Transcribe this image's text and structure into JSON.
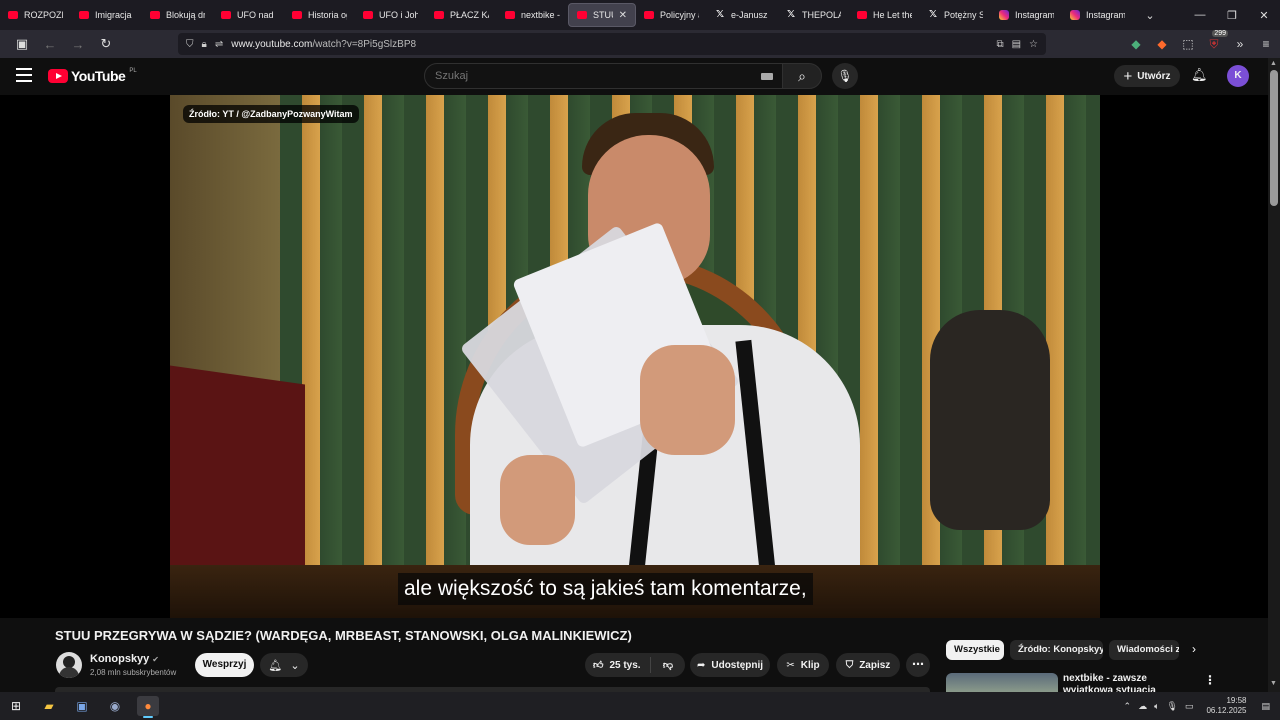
{
  "browser": {
    "tabs": [
      {
        "label": "ROZPOZNA",
        "icon": "youtube-icon"
      },
      {
        "label": "Imigracja w",
        "icon": "youtube-icon"
      },
      {
        "label": "Blokują dro",
        "icon": "youtube-icon"
      },
      {
        "label": "UFO nad W",
        "icon": "youtube-icon"
      },
      {
        "label": "Historia ogl",
        "icon": "youtube-icon"
      },
      {
        "label": "UFO i John",
        "icon": "youtube-icon"
      },
      {
        "label": "PŁACZ KASI",
        "icon": "youtube-icon"
      },
      {
        "label": "nextbike - z",
        "icon": "youtube-icon"
      },
      {
        "label": "STUU PR",
        "icon": "youtube-icon",
        "active": true
      },
      {
        "label": "Policyjny ag",
        "icon": "youtube-icon"
      },
      {
        "label": "e-Janusz Ch",
        "icon": "x-icon"
      },
      {
        "label": "THEPOLAN",
        "icon": "x-icon"
      },
      {
        "label": "He Let the I",
        "icon": "youtube-icon"
      },
      {
        "label": "Potężny Set",
        "icon": "x-icon"
      },
      {
        "label": "Instagram",
        "icon": "instagram-icon"
      },
      {
        "label": "Instagram",
        "icon": "instagram-icon"
      }
    ],
    "url_host": "www.youtube.com",
    "url_path": "/watch?v=8Pi5gSlzBP8",
    "extension_badge": "299"
  },
  "youtube": {
    "logo_text": "YouTube",
    "region": "PL",
    "search_placeholder": "Szukaj",
    "create_label": "Utwórz",
    "avatar_letter": "K"
  },
  "video": {
    "source_overlay": "Źródło: YT / @ZadbanyPozwanyWitam",
    "caption": "ale większość to są jakieś tam komentarze,",
    "title": "STUU PRZEGRYWA W SĄDZIE? (WARDĘGA, MRBEAST, STANOWSKI, OLGA MALINKIEWICZ)"
  },
  "channel": {
    "name": "Konopskyy",
    "subscribers": "2,08 mln subskrybentów",
    "support_label": "Wesprzyj"
  },
  "actions": {
    "likes": "25 tys.",
    "share": "Udostępnij",
    "clip": "Klip",
    "save": "Zapisz"
  },
  "sidebar": {
    "chips": [
      "Wszystkie",
      "Źródło: Konopskyy",
      "Wiadomości z"
    ],
    "recommendation_title": "nextbike - zawsze wyjątkowa sytuacja"
  },
  "taskbar": {
    "time": "19:58",
    "date": "06.12.2025"
  },
  "colors": {
    "youtube_red": "#ff0033",
    "page_bg": "#0f0f0f",
    "avatar_purple": "#7b4fd6"
  }
}
